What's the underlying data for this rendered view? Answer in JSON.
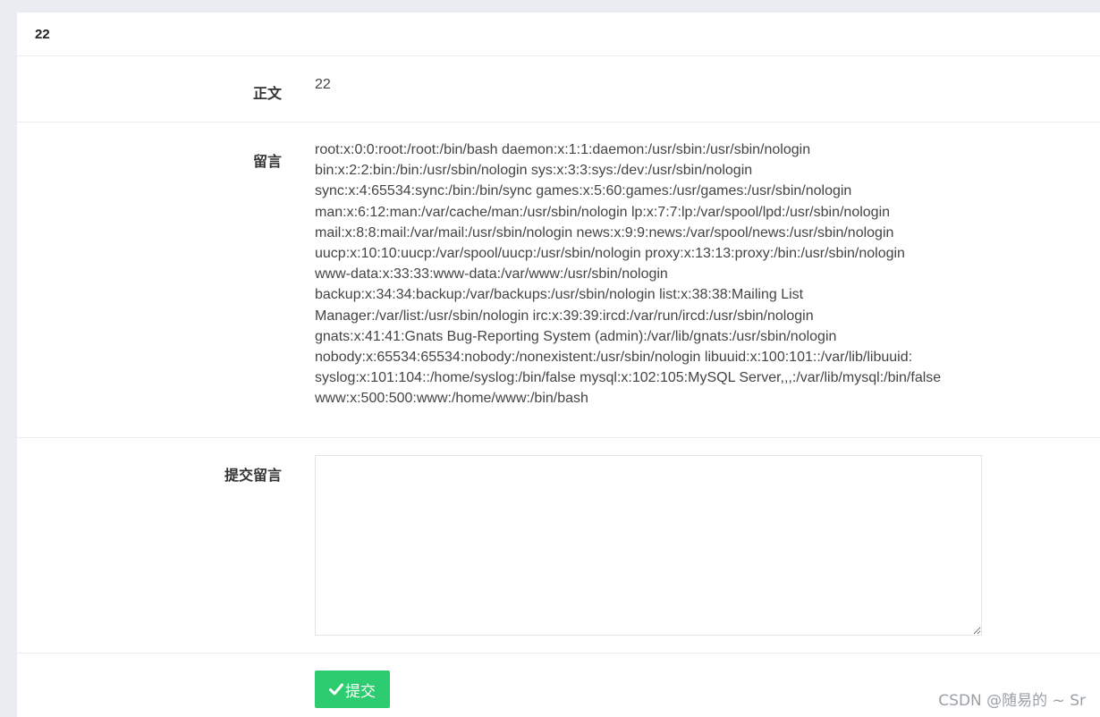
{
  "panel": {
    "title": "22"
  },
  "body_row": {
    "label": "正文",
    "value": "22"
  },
  "message_row": {
    "label": "留言",
    "lines": [
      "root:x:0:0:root:/root:/bin/bash daemon:x:1:1:daemon:/usr/sbin:/usr/sbin/nologin",
      "bin:x:2:2:bin:/bin:/usr/sbin/nologin sys:x:3:3:sys:/dev:/usr/sbin/nologin",
      "sync:x:4:65534:sync:/bin:/bin/sync games:x:5:60:games:/usr/games:/usr/sbin/nologin",
      "man:x:6:12:man:/var/cache/man:/usr/sbin/nologin lp:x:7:7:lp:/var/spool/lpd:/usr/sbin/nologin",
      "mail:x:8:8:mail:/var/mail:/usr/sbin/nologin news:x:9:9:news:/var/spool/news:/usr/sbin/nologin",
      "uucp:x:10:10:uucp:/var/spool/uucp:/usr/sbin/nologin proxy:x:13:13:proxy:/bin:/usr/sbin/nologin",
      "www-data:x:33:33:www-data:/var/www:/usr/sbin/nologin",
      "backup:x:34:34:backup:/var/backups:/usr/sbin/nologin list:x:38:38:Mailing List",
      "Manager:/var/list:/usr/sbin/nologin irc:x:39:39:ircd:/var/run/ircd:/usr/sbin/nologin",
      "gnats:x:41:41:Gnats Bug-Reporting System (admin):/var/lib/gnats:/usr/sbin/nologin",
      "nobody:x:65534:65534:nobody:/nonexistent:/usr/sbin/nologin libuuid:x:100:101::/var/lib/libuuid:",
      "syslog:x:101:104::/home/syslog:/bin/false mysql:x:102:105:MySQL Server,,,:/var/lib/mysql:/bin/false",
      "www:x:500:500:www:/home/www:/bin/bash"
    ]
  },
  "submit_message_row": {
    "label": "提交留言",
    "textarea_value": ""
  },
  "action": {
    "submit_label": "提交",
    "submit_icon": "check-icon",
    "button_color": "#2ecc71"
  },
  "watermark": {
    "text": "CSDN @随易的 ~ Sr"
  }
}
